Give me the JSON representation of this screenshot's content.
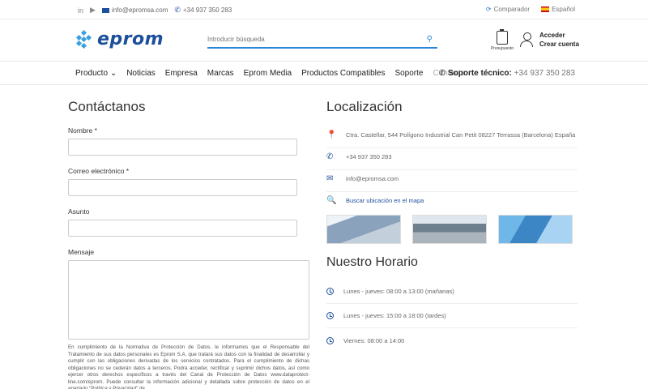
{
  "topbar": {
    "linkedin": "in",
    "youtube": "▶",
    "email": "info@epromsa.com",
    "phone": "+34 937 350 283",
    "compare": "Comparador",
    "language": "Español"
  },
  "header": {
    "logo_text": "eprom",
    "search_placeholder": "Introducir búsqueda",
    "budget_label": "Presupuesto",
    "login": "Acceder",
    "register": "Crear cuenta"
  },
  "nav": {
    "items": [
      "Producto",
      "Noticias",
      "Empresa",
      "Marcas",
      "Eprom Media",
      "Productos Compatibles",
      "Soporte",
      "Contacto"
    ],
    "support_label": "Soporte técnico:",
    "support_phone": "+34 937 350 283"
  },
  "form": {
    "title": "Contáctanos",
    "name_label": "Nombre *",
    "email_label": "Correo electrónico *",
    "subject_label": "Asunto",
    "message_label": "Mensaje",
    "legal": "En cumplimiento de la Normativa de Protección de Datos, le informamos que el Responsable del Tratamiento de sus datos personales es Eprom S.A. que tratará sus datos con la finalidad de desarrollar y cumplir con las obligaciones derivadas de los servicios contratados. Para el cumplimiento de dichas obligaciones no se cederán datos a terceros. Podrá acceder, rectificar y suprimir dichos datos, así como ejercer otros derechos específicos a través del Canal de Protección de Datos www.dataprotect-line.com/eprom. Puede consultar la información adicional y detallada sobre protección de datos en el apartado \"Política y Privacidad\" de"
  },
  "location": {
    "title": "Localización",
    "address": "Ctra. Castellar, 544 Polígono Industrial Can Petit 08227 Terrassa (Barcelona) España",
    "phone": "+34 937 350 283",
    "email": "info@epromsa.com",
    "map_link": "Buscar ubicación en el mapa"
  },
  "hours": {
    "title": "Nuestro Horario",
    "rows": [
      "Lunes - jueves: 08:00 a 13:00 (mañanas)",
      "Lunes - jueves: 15:00 a 18:00 (tardes)",
      "Viernes: 08:00 a 14:00"
    ]
  }
}
